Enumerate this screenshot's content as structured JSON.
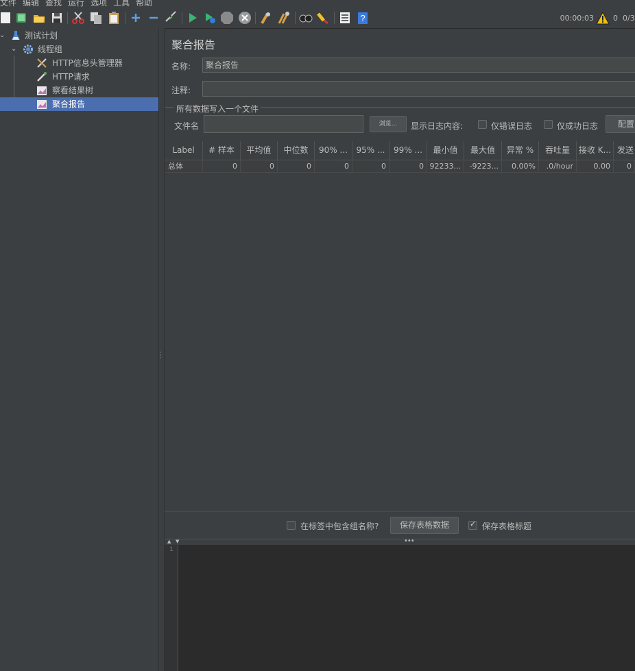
{
  "menu": [
    "文件",
    "编辑",
    "查找",
    "运行",
    "选项",
    "工具",
    "帮助"
  ],
  "toolbar": {
    "timer": "00:00:03",
    "warning_count": "0",
    "threads": "0/3"
  },
  "tree": [
    {
      "label": "测试计划"
    },
    {
      "label": "线程组"
    },
    {
      "label": "HTTP信息头管理器"
    },
    {
      "label": "HTTP请求"
    },
    {
      "label": "察看结果树"
    },
    {
      "label": "聚合报告"
    }
  ],
  "panel": {
    "title": "聚合报告",
    "name_label": "名称:",
    "name_value": "聚合报告",
    "comment_label": "注释:",
    "comment_value": "",
    "group_title": "所有数据写入一个文件",
    "filename_label": "文件名",
    "filename_value": "",
    "browse_label": "浏览...",
    "log_label": "显示日志内容:",
    "errors_only_label": "仅错误日志",
    "success_only_label": "仅成功日志",
    "config_label": "配置"
  },
  "table": {
    "headers": [
      "Label",
      "# 样本",
      "平均值",
      "中位数",
      "90% ...",
      "95% ...",
      "99% ...",
      "最小值",
      "最大值",
      "异常 %",
      "吞吐量",
      "接收 K...",
      "发送"
    ],
    "rows": [
      [
        "总体",
        "0",
        "0",
        "0",
        "0",
        "0",
        "0",
        "92233...",
        "-9223...",
        "0.00%",
        ".0/hour",
        "0.00",
        "0"
      ]
    ]
  },
  "bottom": {
    "include_group_label": "在标签中包含组名称?",
    "save_table_label": "保存表格数据",
    "save_header_label": "保存表格标题"
  },
  "editor": {
    "line_number": "1"
  }
}
